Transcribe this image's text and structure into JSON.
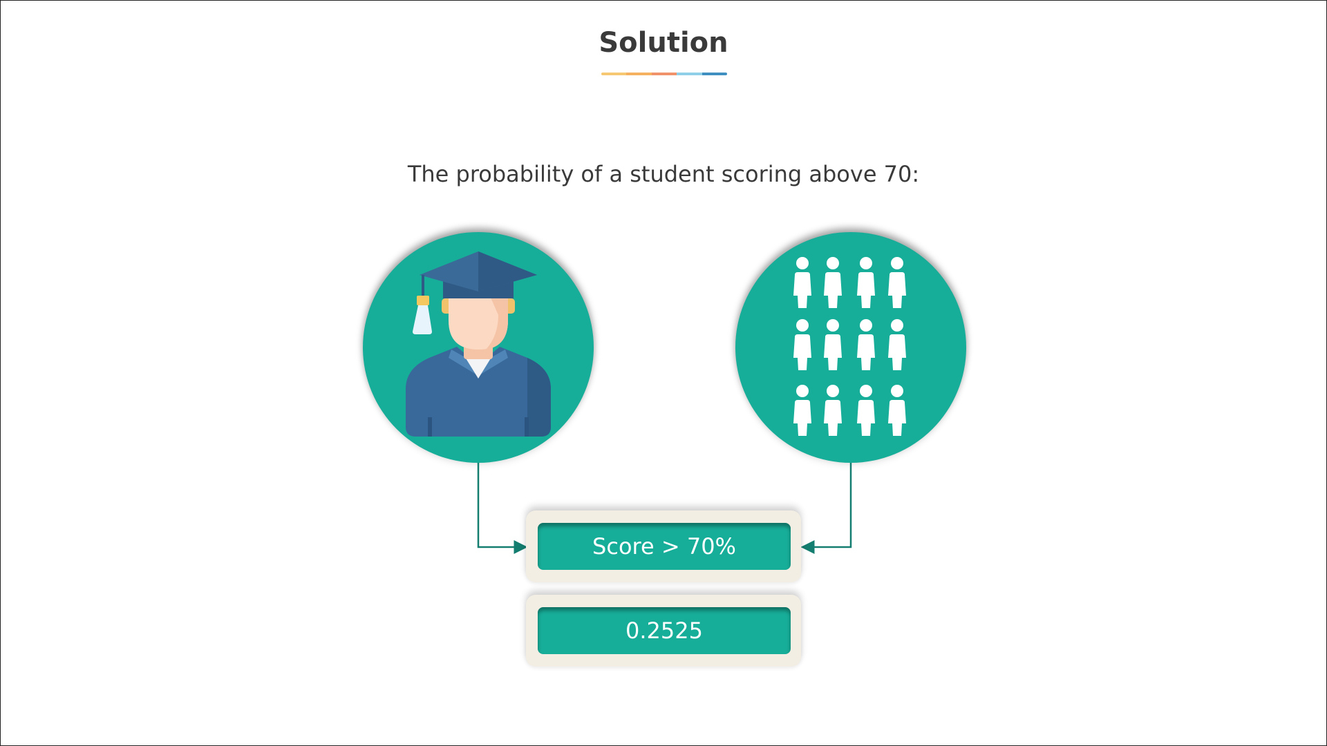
{
  "slide": {
    "title": "Solution",
    "underline_colors": [
      "#f7c873",
      "#f5b060",
      "#f0926a",
      "#8fd0e8",
      "#3f8fc1"
    ],
    "subtitle": "The probability of a student scoring above 70:"
  },
  "diagram": {
    "left_node": {
      "icon": "graduate-student-icon"
    },
    "right_node": {
      "icon": "student-group-icon",
      "figure_count": 12
    },
    "condition_label": "Score > 70%",
    "result_value": "0.2525"
  },
  "colors": {
    "teal": "#17ae99",
    "connector": "#137d70",
    "box_frame": "#f2eee3",
    "cap_blue": "#3a6a98",
    "gown_blue": "#38699a",
    "skin": "#fcd9c3",
    "tassel": "#f5c85f"
  }
}
